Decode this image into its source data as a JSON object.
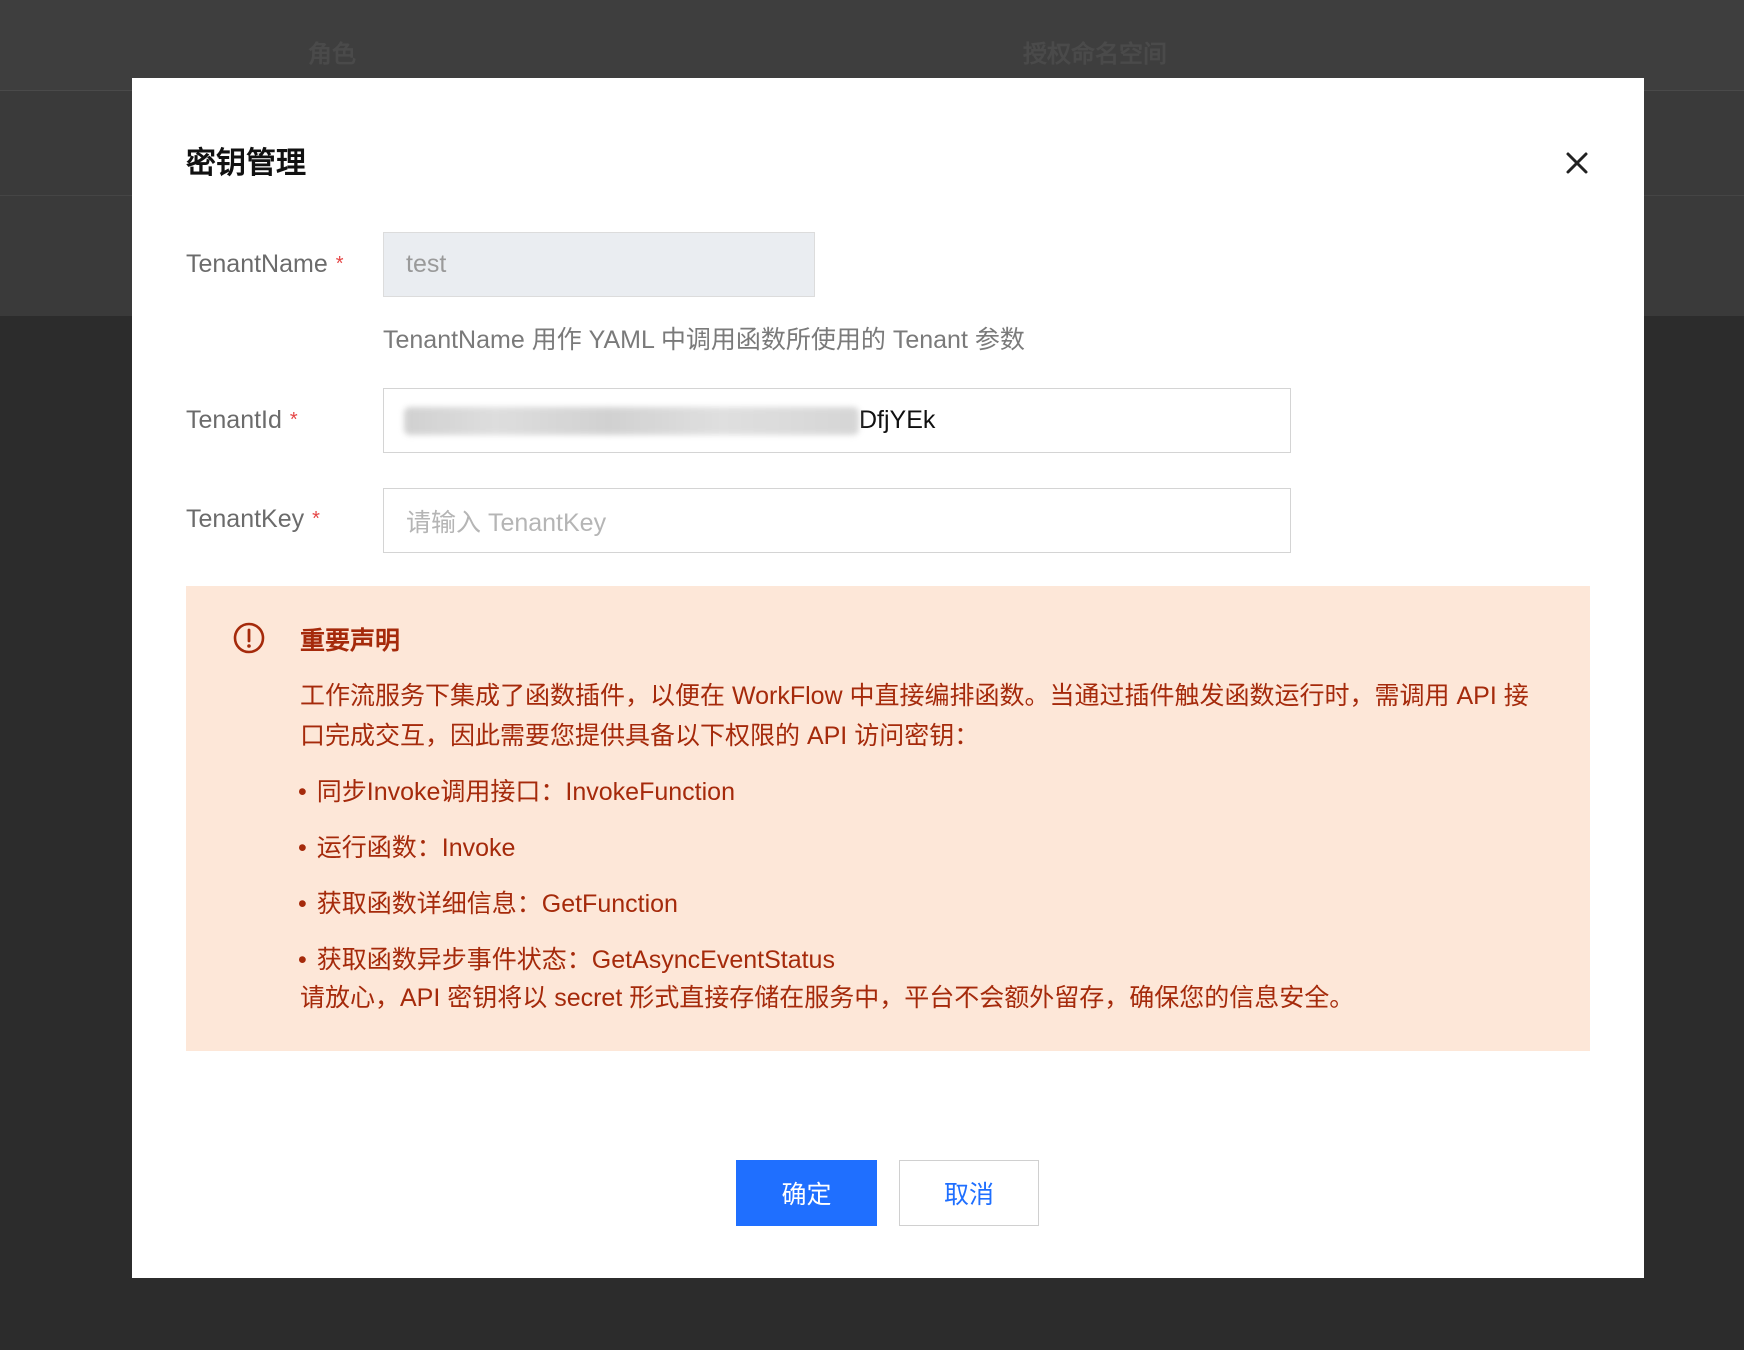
{
  "background": {
    "columns": [
      "角色",
      "授权命名空间"
    ]
  },
  "modal": {
    "title": "密钥管理",
    "close_icon": "close-icon",
    "fields": {
      "tenant_name": {
        "label": "TenantName",
        "value": "test",
        "required_mark": "*"
      },
      "tenant_name_hint": "TenantName 用作 YAML 中调用函数所使用的 Tenant 参数",
      "tenant_id": {
        "label": "TenantId",
        "value_visible_suffix": "DfjYEk",
        "required_mark": "*"
      },
      "tenant_key": {
        "label": "TenantKey",
        "placeholder": "请输入 TenantKey",
        "required_mark": "*"
      }
    },
    "notice": {
      "icon": "alert-circle-icon",
      "title": "重要声明",
      "body": "工作流服务下集成了函数插件，以便在 WorkFlow 中直接编排函数。当通过插件触发函数运行时，需调用 API 接口完成交互，因此需要您提供具备以下权限的 API 访问密钥：",
      "items": [
        "同步Invoke调用接口：InvokeFunction",
        "运行函数：Invoke",
        "获取函数详细信息：GetFunction",
        "获取函数异步事件状态：GetAsyncEventStatus"
      ],
      "footer": "请放心，API 密钥将以 secret 形式直接存储在服务中，平台不会额外留存，确保您的信息安全。"
    },
    "buttons": {
      "ok": "确定",
      "cancel": "取消"
    }
  },
  "colors": {
    "primary": "#1f6fff",
    "notice_bg": "#fde7d8",
    "notice_text": "#a52a0b",
    "required": "#e54545"
  }
}
